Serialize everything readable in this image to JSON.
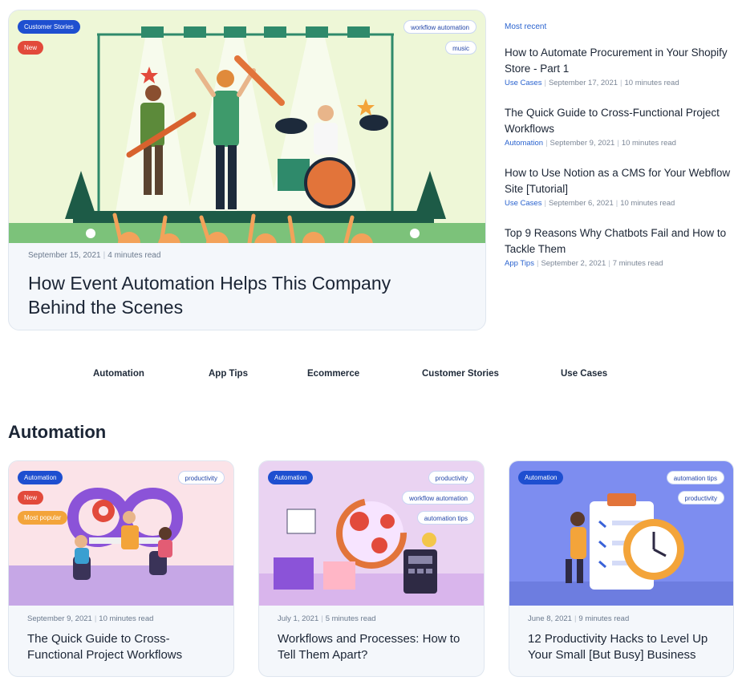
{
  "featured": {
    "badges": [
      "Customer Stories",
      "New"
    ],
    "tags": [
      "workflow automation",
      "music"
    ],
    "date": "September 15, 2021",
    "read_time": "4 minutes read",
    "title": "How Event Automation Helps This Company Behind the Scenes"
  },
  "recent": {
    "heading": "Most recent",
    "items": [
      {
        "title": "How to Automate Procurement in Your Shopify Store - Part 1",
        "category": "Use Cases",
        "date": "September 17, 2021",
        "read_time": "10 minutes read"
      },
      {
        "title": "The Quick Guide to Cross-Functional Project Workflows",
        "category": "Automation",
        "date": "September 9, 2021",
        "read_time": "10 minutes read"
      },
      {
        "title": "How to Use Notion as a CMS for Your Webflow Site [Tutorial]",
        "category": "Use Cases",
        "date": "September 6, 2021",
        "read_time": "10 minutes read"
      },
      {
        "title": "Top 9 Reasons Why Chatbots Fail and How to Tackle Them",
        "category": "App Tips",
        "date": "September 2, 2021",
        "read_time": "7 minutes read"
      }
    ]
  },
  "category_nav": [
    "Automation",
    "App Tips",
    "Ecommerce",
    "Customer Stories",
    "Use Cases"
  ],
  "section": {
    "title": "Automation"
  },
  "cards": [
    {
      "badges": [
        "Automation",
        "New",
        "Most popular"
      ],
      "tags": [
        "productivity"
      ],
      "date": "September 9, 2021",
      "read_time": "10 minutes read",
      "title": "The Quick Guide to Cross-Functional Project Workflows"
    },
    {
      "badges": [
        "Automation"
      ],
      "tags": [
        "productivity",
        "workflow automation",
        "automation tips"
      ],
      "date": "July 1, 2021",
      "read_time": "5 minutes read",
      "title": "Workflows and Processes: How to Tell Them Apart?"
    },
    {
      "badges": [
        "Automation"
      ],
      "tags": [
        "automation tips",
        "productivity"
      ],
      "date": "June 8, 2021",
      "read_time": "9 minutes read",
      "title": "12 Productivity Hacks to Level Up Your Small [But Busy] Business"
    }
  ],
  "colors": {
    "accent": "#1e4fd0",
    "new_badge": "#e24a3b",
    "popular_badge": "#f3a43a",
    "link": "#2a63cf"
  },
  "icons": [
    "concert-illustration",
    "infinity-team-illustration",
    "gears-process-illustration",
    "checklist-clock-illustration"
  ]
}
